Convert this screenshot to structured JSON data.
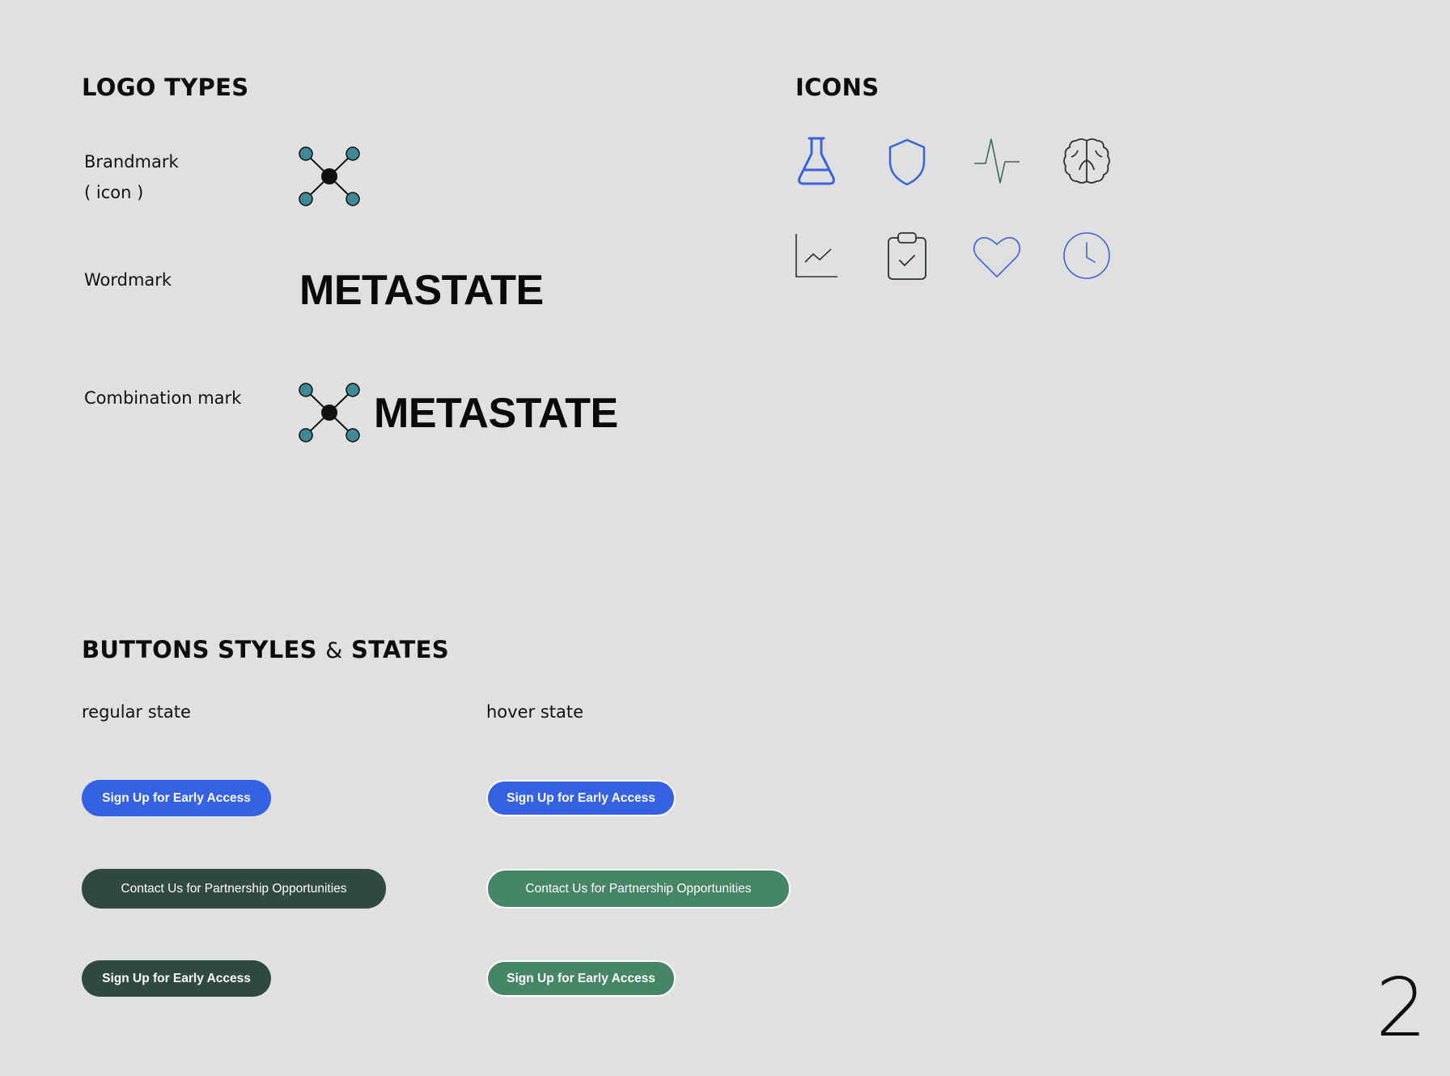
{
  "logo_types": {
    "title": "LOGO TYPES",
    "brandmark_label": "Brandmark",
    "brandmark_sublabel": "( icon )",
    "wordmark_label": "Wordmark",
    "wordmark_text": "METASTATE",
    "combination_label": "Combination mark",
    "combination_text": "METASTATE",
    "node_color": "#3f8a99",
    "center_color": "#111111"
  },
  "icons": {
    "title": "ICONS",
    "items": [
      "flask-icon",
      "shield-icon",
      "pulse-icon",
      "brain-icon",
      "line-chart-icon",
      "clipboard-check-icon",
      "heart-icon",
      "clock-icon"
    ],
    "blue": "#3a64dc",
    "green": "#3d6b55",
    "dark": "#2a332e"
  },
  "buttons": {
    "title_part1": "BUTTONS STYLES",
    "title_amp": "&",
    "title_part2": "STATES",
    "regular_label": "regular state",
    "hover_label": "hover state",
    "early_access_label": "Sign Up for Early Access",
    "partnership_label": "Contact Us for Partnership Opportunities",
    "colors": {
      "blue": "#3561e3",
      "dark_green": "#314a3f",
      "light_green": "#468565"
    }
  },
  "page_number": "2"
}
